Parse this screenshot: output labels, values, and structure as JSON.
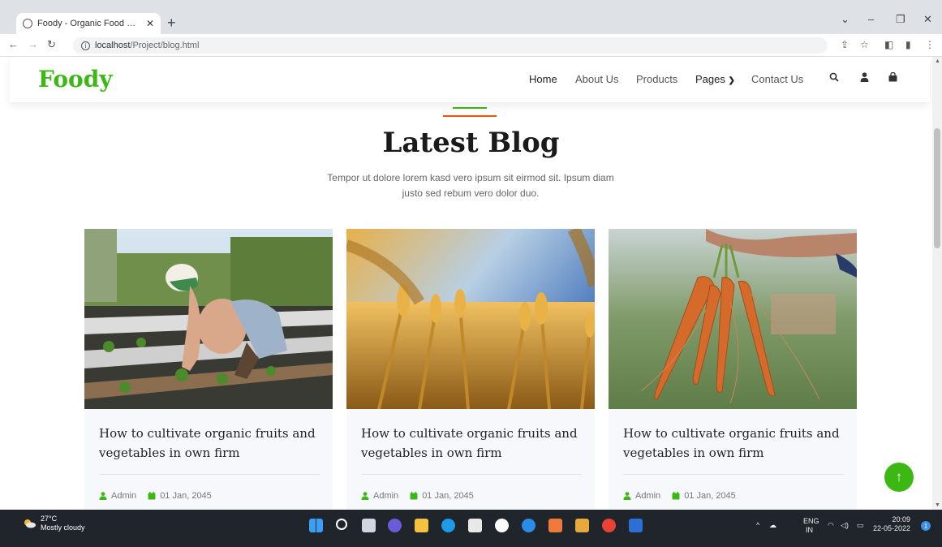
{
  "browser": {
    "tab_title": "Foody - Organic Food Website Te",
    "tab_close": "✕",
    "new_tab": "+",
    "url_host": "localhost",
    "url_path": "/Project/blog.html",
    "win_minimize": "–",
    "win_restore": "❐",
    "win_close": "✕",
    "win_dropdown": "⌄"
  },
  "site": {
    "brand": "Foody",
    "accent_color": "#3cb815",
    "secondary_color": "#f65005",
    "menu": [
      {
        "label": "Home"
      },
      {
        "label": "About Us"
      },
      {
        "label": "Products"
      },
      {
        "label": "Pages"
      },
      {
        "label": "Contact Us"
      }
    ],
    "pages_caret": "⌄"
  },
  "section": {
    "title": "Latest Blog",
    "subtitle": "Tempor ut dolore lorem kasd vero ipsum sit eirmod sit. Ipsum diam justo sed rebum vero dolor duo."
  },
  "posts": [
    {
      "title": "How to cultivate organic fruits and vegetables in own firm",
      "author": "Admin",
      "date": "01 Jan, 2045",
      "image": "farmer-planting-photo"
    },
    {
      "title": "How to cultivate organic fruits and vegetables in own firm",
      "author": "Admin",
      "date": "01 Jan, 2045",
      "image": "wheat-field-photo"
    },
    {
      "title": "How to cultivate organic fruits and vegetables in own firm",
      "author": "Admin",
      "date": "01 Jan, 2045",
      "image": "carrots-harvest-photo"
    }
  ],
  "back_to_top": "↑",
  "taskbar": {
    "temperature": "27°C",
    "weather": "Mostly cloudy",
    "lang": "ENG",
    "region": "IN",
    "time": "20:09",
    "date": "22-05-2022",
    "notifications": "1"
  }
}
